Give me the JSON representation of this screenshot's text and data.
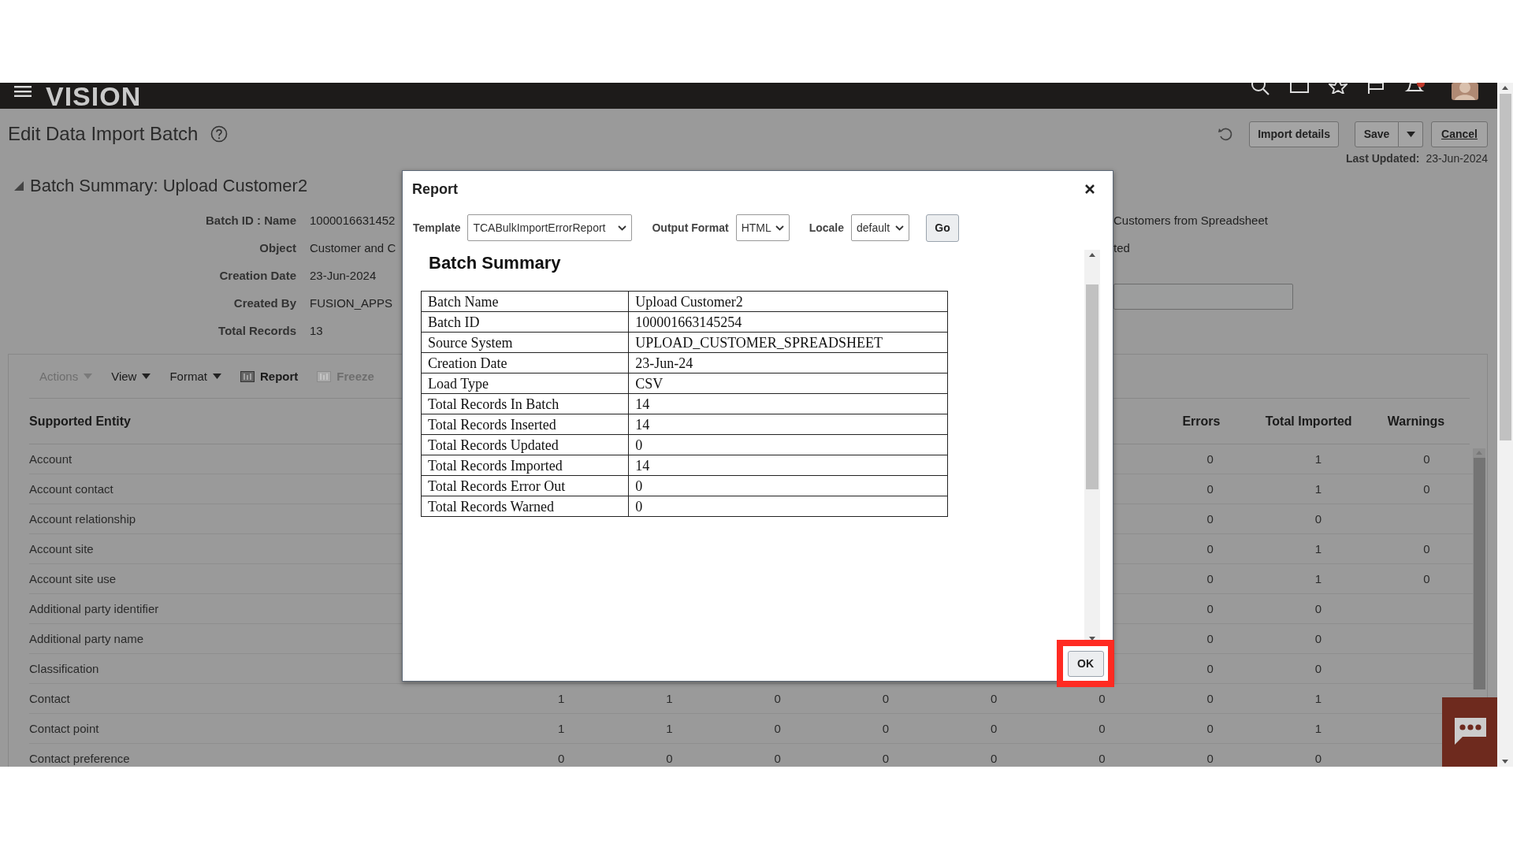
{
  "header": {
    "logo": "VISION"
  },
  "page": {
    "title": "Edit Data Import Batch",
    "import_details": "Import details",
    "save": "Save",
    "cancel": "Cancel",
    "last_updated_label": "Last Updated:",
    "last_updated": "23-Jun-2024"
  },
  "batch_summary": {
    "title": "Batch Summary: Upload Customer2",
    "expanded": true,
    "fields": [
      {
        "label": "Batch ID : Name",
        "value": "1000016631452"
      },
      {
        "label": "Object",
        "value": "Customer and C"
      },
      {
        "label": "Creation Date",
        "value": "23-Jun-2024"
      },
      {
        "label": "Created By",
        "value": "FUSION_APPS"
      },
      {
        "label": "Total Records",
        "value": "13"
      }
    ],
    "right_texts": [
      "Customers from Spreadsheet",
      "ted"
    ]
  },
  "toolbar": [
    {
      "label": "Actions",
      "kind": "menu",
      "disabled": true
    },
    {
      "label": "View",
      "kind": "menu",
      "disabled": false
    },
    {
      "label": "Format",
      "kind": "menu",
      "disabled": false
    },
    {
      "label": "Report",
      "kind": "icon-button",
      "disabled": false
    },
    {
      "label": "Freeze",
      "kind": "icon-button",
      "disabled": true
    }
  ],
  "table": {
    "headers": {
      "entity": "Supported Entity",
      "errors": "Errors",
      "total_imported": "Total Imported",
      "warnings": "Warnings"
    },
    "rows": [
      {
        "entity": "Account",
        "errors": "0",
        "total_imported": "1",
        "warnings": "0"
      },
      {
        "entity": "Account contact",
        "errors": "0",
        "total_imported": "1",
        "warnings": "0"
      },
      {
        "entity": "Account relationship",
        "errors": "0",
        "total_imported": "0"
      },
      {
        "entity": "Account site",
        "errors": "0",
        "total_imported": "1",
        "warnings": "0"
      },
      {
        "entity": "Account site use",
        "errors": "0",
        "total_imported": "1",
        "warnings": "0"
      },
      {
        "entity": "Additional party identifier",
        "errors": "0",
        "total_imported": "0"
      },
      {
        "entity": "Additional party name",
        "errors": "0",
        "total_imported": "0"
      },
      {
        "entity": "Classification",
        "errors": "0",
        "total_imported": "0"
      },
      {
        "entity": "Contact",
        "column_2": "1",
        "column_3": "1",
        "column_4": "0",
        "column_5": "0",
        "column_6": "0",
        "column_7": "0",
        "errors": "0",
        "total_imported": "1"
      },
      {
        "entity": "Contact point",
        "column_2": "1",
        "column_3": "1",
        "column_4": "0",
        "column_5": "0",
        "column_6": "0",
        "column_7": "0",
        "errors": "0",
        "total_imported": "1"
      },
      {
        "entity": "Contact preference",
        "column_2": "0",
        "column_3": "0",
        "column_4": "0",
        "column_5": "0",
        "column_6": "0",
        "column_7": "0",
        "errors": "0",
        "total_imported": "0"
      }
    ]
  },
  "dialog": {
    "title": "Report",
    "selects": [
      {
        "label": "Template",
        "value": "TCABulkImportErrorReport"
      },
      {
        "label": "Output Format",
        "value": "HTML"
      },
      {
        "label": "Locale",
        "value": "default"
      }
    ],
    "go": "Go",
    "report_title": "Batch Summary",
    "summary": [
      {
        "name": "Batch Name",
        "value": "Upload Customer2"
      },
      {
        "name": "Batch ID",
        "value": "100001663145254"
      },
      {
        "name": "Source System",
        "value": "UPLOAD_CUSTOMER_SPREADSHEET"
      },
      {
        "name": "Creation Date",
        "value": "23-Jun-24"
      },
      {
        "name": "Load Type",
        "value": "CSV"
      },
      {
        "name": "Total Records In Batch",
        "value": "14"
      },
      {
        "name": "Total Records Inserted",
        "value": "14"
      },
      {
        "name": "Total Records Updated",
        "value": "0"
      },
      {
        "name": "Total Records Imported",
        "value": "14"
      },
      {
        "name": "Total Records Error Out",
        "value": "0"
      },
      {
        "name": "Total Records Warned",
        "value": "0"
      }
    ],
    "ok": "OK",
    "ok_highlighted": true
  }
}
